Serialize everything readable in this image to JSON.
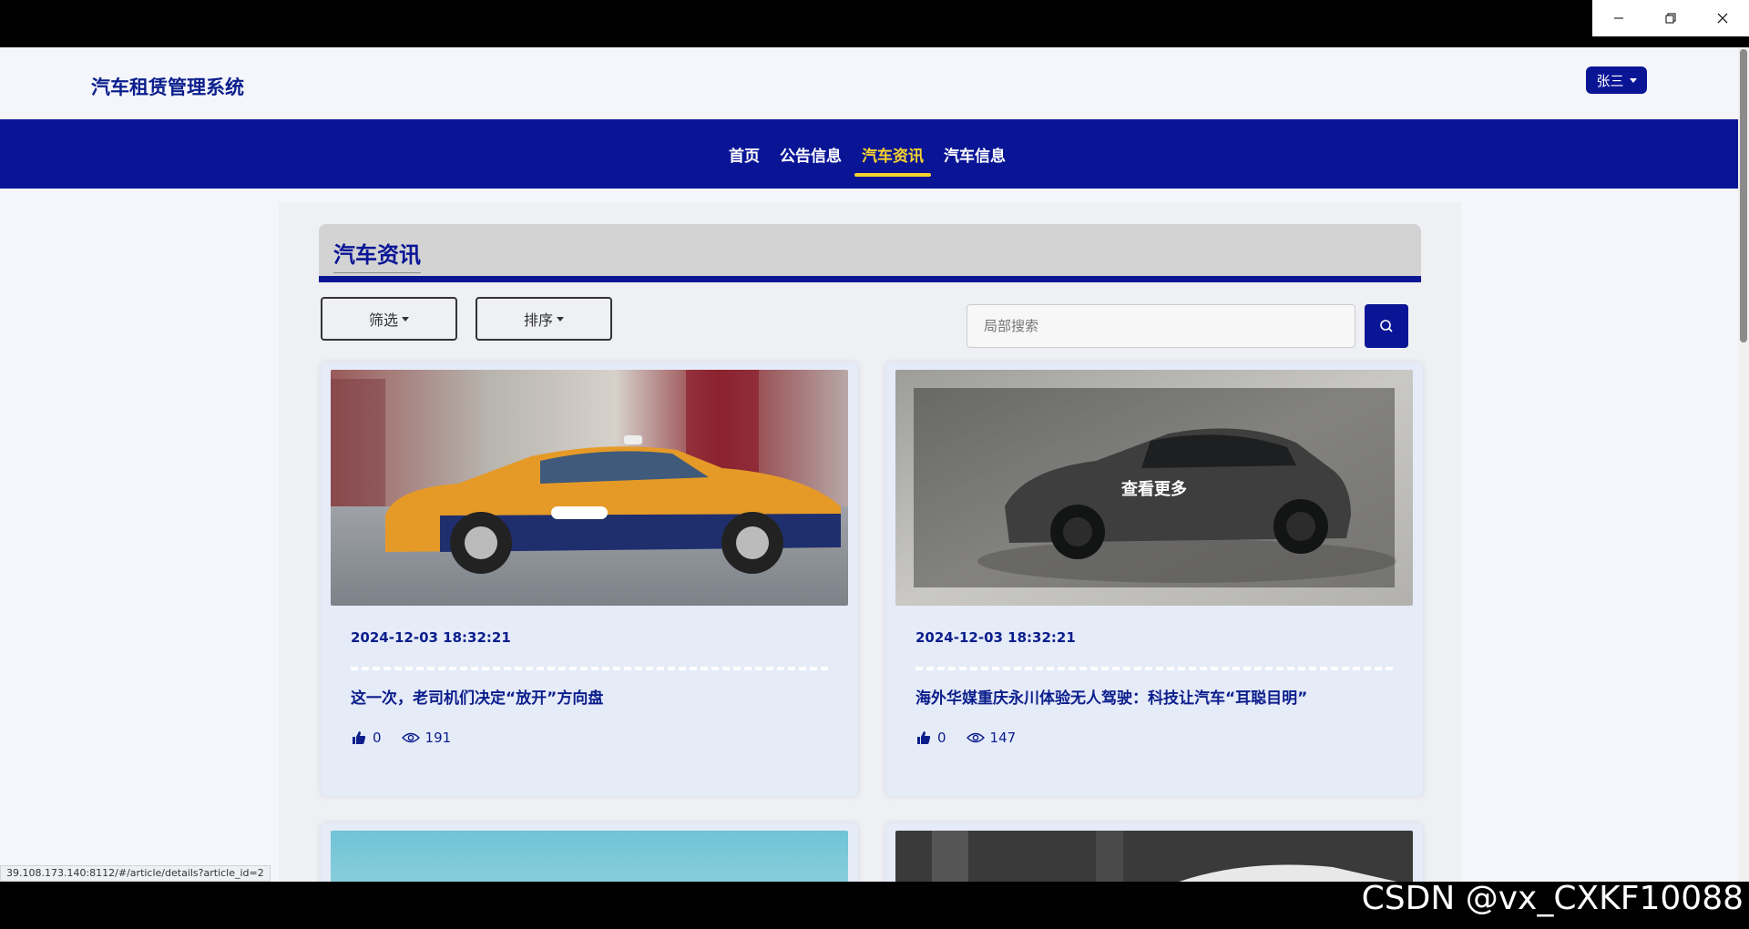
{
  "window": {
    "controls": [
      "minimize",
      "restore",
      "close"
    ]
  },
  "header": {
    "site_title": "汽车租赁管理系统",
    "user_label": "张三"
  },
  "nav": {
    "items": [
      {
        "label": "首页",
        "active": false
      },
      {
        "label": "公告信息",
        "active": false
      },
      {
        "label": "汽车资讯",
        "active": true
      },
      {
        "label": "汽车信息",
        "active": false
      }
    ]
  },
  "section": {
    "title": "汽车资讯"
  },
  "toolbar": {
    "filter_label": "筛选",
    "sort_label": "排序",
    "search_placeholder": "局部搜索"
  },
  "articles": [
    {
      "date": "2024-12-03 18:32:21",
      "title": "这一次，老司机们决定“放开”方向盘",
      "likes": "0",
      "views": "191",
      "image": "taxi-photo"
    },
    {
      "date": "2024-12-03 18:32:21",
      "title": "海外华媒重庆永川体验无人驾驶：科技让汽车“耳聪目明”",
      "likes": "0",
      "views": "147",
      "image": "grey-car-photo",
      "overlay_label": "查看更多"
    }
  ],
  "status_url": "39.108.173.140:8112/#/article/details?article_id=2",
  "watermark": "CSDN @vx_CXKF10088",
  "colors": {
    "brand": "#0a1596",
    "nav_active": "#f6d32d",
    "text_primary": "#0b1e8c"
  }
}
